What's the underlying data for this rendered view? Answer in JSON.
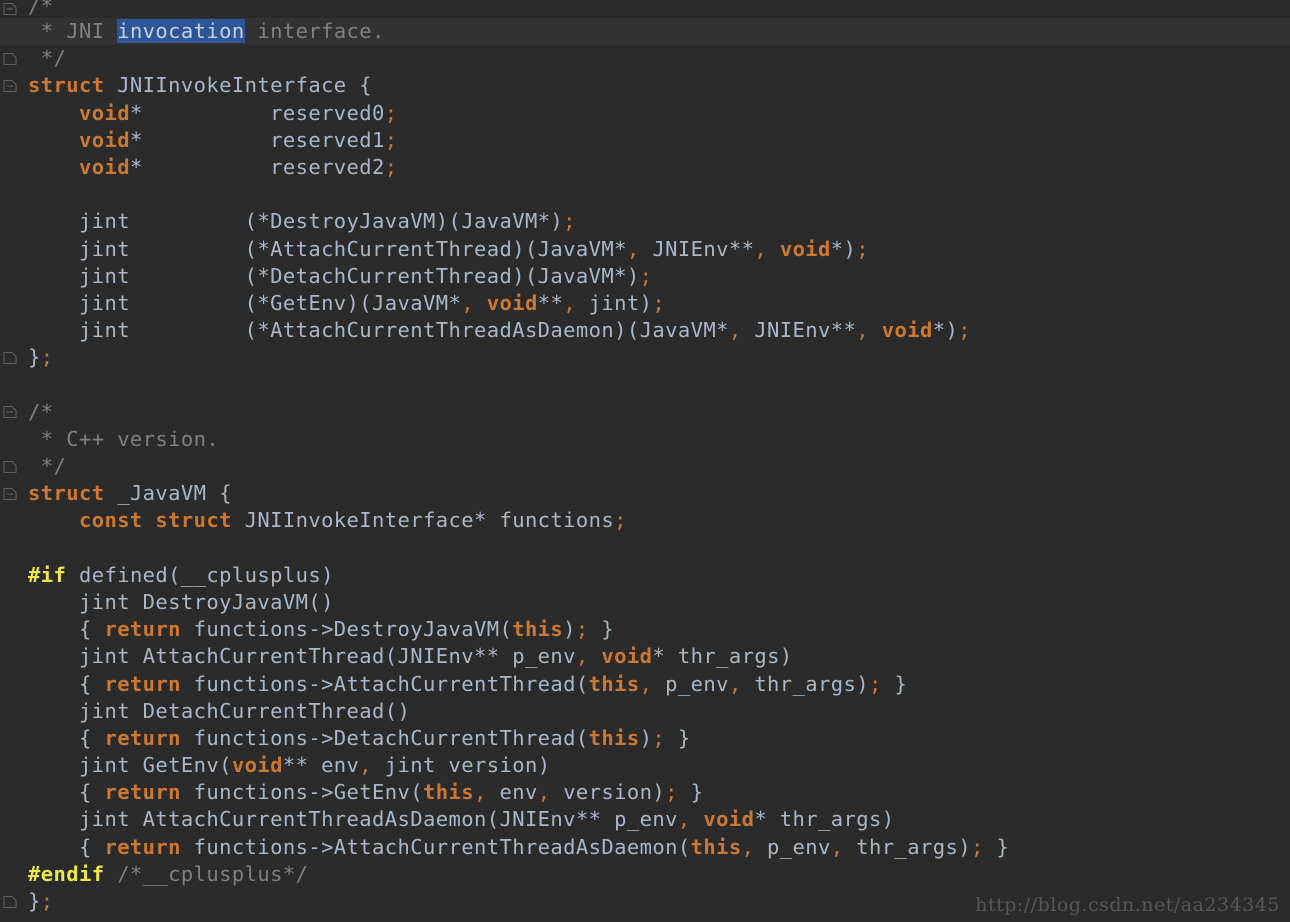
{
  "editor": {
    "theme_name": "darcula",
    "colors": {
      "background": "#2b2b2b",
      "highlight_line": "#323232",
      "keyword": "#cc7832",
      "identifier": "#a9b7c6",
      "comment": "#808080",
      "preprocessor": "#e8e84a",
      "selection": "#2c5699",
      "gutter_fold": "#606060",
      "watermark": "#575757"
    },
    "watermark": "http://blog.csdn.net/aa234345",
    "lines": [
      {
        "id": "line-1",
        "fold": "start",
        "highlight": false,
        "tokens": [
          {
            "t": "/*",
            "c": "cm"
          }
        ]
      },
      {
        "id": "line-2",
        "fold": "none",
        "highlight": true,
        "tokens": [
          {
            "t": " * JNI ",
            "c": "cm"
          },
          {
            "t": "invocation",
            "c": "sel"
          },
          {
            "t": " interface.",
            "c": "cm"
          }
        ]
      },
      {
        "id": "line-3",
        "fold": "end",
        "highlight": false,
        "tokens": [
          {
            "t": " */",
            "c": "cm"
          }
        ]
      },
      {
        "id": "line-4",
        "fold": "start",
        "highlight": false,
        "tokens": [
          {
            "t": "struct",
            "c": "kw"
          },
          {
            "t": " JNIInvokeInterface {",
            "c": "id"
          }
        ]
      },
      {
        "id": "line-5",
        "fold": "none",
        "highlight": false,
        "tokens": [
          {
            "t": "    ",
            "c": "id"
          },
          {
            "t": "void",
            "c": "kw"
          },
          {
            "t": "*          reserved0",
            "c": "id"
          },
          {
            "t": ";",
            "c": "pn"
          }
        ]
      },
      {
        "id": "line-6",
        "fold": "none",
        "highlight": false,
        "tokens": [
          {
            "t": "    ",
            "c": "id"
          },
          {
            "t": "void",
            "c": "kw"
          },
          {
            "t": "*          reserved1",
            "c": "id"
          },
          {
            "t": ";",
            "c": "pn"
          }
        ]
      },
      {
        "id": "line-7",
        "fold": "none",
        "highlight": false,
        "tokens": [
          {
            "t": "    ",
            "c": "id"
          },
          {
            "t": "void",
            "c": "kw"
          },
          {
            "t": "*          reserved2",
            "c": "id"
          },
          {
            "t": ";",
            "c": "pn"
          }
        ]
      },
      {
        "id": "line-8",
        "fold": "none",
        "highlight": false,
        "tokens": [
          {
            "t": "",
            "c": "id"
          }
        ]
      },
      {
        "id": "line-9",
        "fold": "none",
        "highlight": false,
        "tokens": [
          {
            "t": "    jint         (*DestroyJavaVM)(JavaVM*)",
            "c": "id"
          },
          {
            "t": ";",
            "c": "pn"
          }
        ]
      },
      {
        "id": "line-10",
        "fold": "none",
        "highlight": false,
        "tokens": [
          {
            "t": "    jint         (*AttachCurrentThread)(JavaVM*",
            "c": "id"
          },
          {
            "t": ",",
            "c": "pn"
          },
          {
            "t": " JNIEnv**",
            "c": "id"
          },
          {
            "t": ",",
            "c": "pn"
          },
          {
            "t": " ",
            "c": "id"
          },
          {
            "t": "void",
            "c": "kw"
          },
          {
            "t": "*)",
            "c": "id"
          },
          {
            "t": ";",
            "c": "pn"
          }
        ]
      },
      {
        "id": "line-11",
        "fold": "none",
        "highlight": false,
        "tokens": [
          {
            "t": "    jint         (*DetachCurrentThread)(JavaVM*)",
            "c": "id"
          },
          {
            "t": ";",
            "c": "pn"
          }
        ]
      },
      {
        "id": "line-12",
        "fold": "none",
        "highlight": false,
        "tokens": [
          {
            "t": "    jint         (*GetEnv)(JavaVM*",
            "c": "id"
          },
          {
            "t": ",",
            "c": "pn"
          },
          {
            "t": " ",
            "c": "id"
          },
          {
            "t": "void",
            "c": "kw"
          },
          {
            "t": "**",
            "c": "id"
          },
          {
            "t": ",",
            "c": "pn"
          },
          {
            "t": " jint)",
            "c": "id"
          },
          {
            "t": ";",
            "c": "pn"
          }
        ]
      },
      {
        "id": "line-13",
        "fold": "none",
        "highlight": false,
        "tokens": [
          {
            "t": "    jint         (*AttachCurrentThreadAsDaemon)(JavaVM*",
            "c": "id"
          },
          {
            "t": ",",
            "c": "pn"
          },
          {
            "t": " JNIEnv**",
            "c": "id"
          },
          {
            "t": ",",
            "c": "pn"
          },
          {
            "t": " ",
            "c": "id"
          },
          {
            "t": "void",
            "c": "kw"
          },
          {
            "t": "*)",
            "c": "id"
          },
          {
            "t": ";",
            "c": "pn"
          }
        ]
      },
      {
        "id": "line-14",
        "fold": "end",
        "highlight": false,
        "tokens": [
          {
            "t": "}",
            "c": "id"
          },
          {
            "t": ";",
            "c": "pn"
          }
        ]
      },
      {
        "id": "line-15",
        "fold": "none",
        "highlight": false,
        "tokens": [
          {
            "t": "",
            "c": "id"
          }
        ]
      },
      {
        "id": "line-16",
        "fold": "start",
        "highlight": false,
        "tokens": [
          {
            "t": "/*",
            "c": "cm"
          }
        ]
      },
      {
        "id": "line-17",
        "fold": "none",
        "highlight": false,
        "tokens": [
          {
            "t": " * C++ version.",
            "c": "cm"
          }
        ]
      },
      {
        "id": "line-18",
        "fold": "end",
        "highlight": false,
        "tokens": [
          {
            "t": " */",
            "c": "cm"
          }
        ]
      },
      {
        "id": "line-19",
        "fold": "start",
        "highlight": false,
        "tokens": [
          {
            "t": "struct",
            "c": "kw"
          },
          {
            "t": " _JavaVM {",
            "c": "id"
          }
        ]
      },
      {
        "id": "line-20",
        "fold": "none",
        "highlight": false,
        "tokens": [
          {
            "t": "    ",
            "c": "id"
          },
          {
            "t": "const struct",
            "c": "kw"
          },
          {
            "t": " JNIInvokeInterface* functions",
            "c": "id"
          },
          {
            "t": ";",
            "c": "pn"
          }
        ]
      },
      {
        "id": "line-21",
        "fold": "none",
        "highlight": false,
        "tokens": [
          {
            "t": "",
            "c": "id"
          }
        ]
      },
      {
        "id": "line-22",
        "fold": "none",
        "highlight": false,
        "tokens": [
          {
            "t": "#if",
            "c": "pp"
          },
          {
            "t": " defined(__cplusplus)",
            "c": "id"
          }
        ]
      },
      {
        "id": "line-23",
        "fold": "none",
        "highlight": false,
        "tokens": [
          {
            "t": "    jint DestroyJavaVM()",
            "c": "id"
          }
        ]
      },
      {
        "id": "line-24",
        "fold": "none",
        "highlight": false,
        "tokens": [
          {
            "t": "    { ",
            "c": "id"
          },
          {
            "t": "return",
            "c": "kw"
          },
          {
            "t": " functions->DestroyJavaVM(",
            "c": "id"
          },
          {
            "t": "this",
            "c": "kw"
          },
          {
            "t": ")",
            "c": "id"
          },
          {
            "t": ";",
            "c": "pn"
          },
          {
            "t": " }",
            "c": "id"
          }
        ]
      },
      {
        "id": "line-25",
        "fold": "none",
        "highlight": false,
        "tokens": [
          {
            "t": "    jint AttachCurrentThread(JNIEnv** p_env",
            "c": "id"
          },
          {
            "t": ",",
            "c": "pn"
          },
          {
            "t": " ",
            "c": "id"
          },
          {
            "t": "void",
            "c": "kw"
          },
          {
            "t": "* thr_args)",
            "c": "id"
          }
        ]
      },
      {
        "id": "line-26",
        "fold": "none",
        "highlight": false,
        "tokens": [
          {
            "t": "    { ",
            "c": "id"
          },
          {
            "t": "return",
            "c": "kw"
          },
          {
            "t": " functions->AttachCurrentThread(",
            "c": "id"
          },
          {
            "t": "this",
            "c": "kw"
          },
          {
            "t": ",",
            "c": "pn"
          },
          {
            "t": " p_env",
            "c": "id"
          },
          {
            "t": ",",
            "c": "pn"
          },
          {
            "t": " thr_args)",
            "c": "id"
          },
          {
            "t": ";",
            "c": "pn"
          },
          {
            "t": " }",
            "c": "id"
          }
        ]
      },
      {
        "id": "line-27",
        "fold": "none",
        "highlight": false,
        "tokens": [
          {
            "t": "    jint DetachCurrentThread()",
            "c": "id"
          }
        ]
      },
      {
        "id": "line-28",
        "fold": "none",
        "highlight": false,
        "tokens": [
          {
            "t": "    { ",
            "c": "id"
          },
          {
            "t": "return",
            "c": "kw"
          },
          {
            "t": " functions->DetachCurrentThread(",
            "c": "id"
          },
          {
            "t": "this",
            "c": "kw"
          },
          {
            "t": ")",
            "c": "id"
          },
          {
            "t": ";",
            "c": "pn"
          },
          {
            "t": " }",
            "c": "id"
          }
        ]
      },
      {
        "id": "line-29",
        "fold": "none",
        "highlight": false,
        "tokens": [
          {
            "t": "    jint GetEnv(",
            "c": "id"
          },
          {
            "t": "void",
            "c": "kw"
          },
          {
            "t": "** env",
            "c": "id"
          },
          {
            "t": ",",
            "c": "pn"
          },
          {
            "t": " jint version)",
            "c": "id"
          }
        ]
      },
      {
        "id": "line-30",
        "fold": "none",
        "highlight": false,
        "tokens": [
          {
            "t": "    { ",
            "c": "id"
          },
          {
            "t": "return",
            "c": "kw"
          },
          {
            "t": " functions->GetEnv(",
            "c": "id"
          },
          {
            "t": "this",
            "c": "kw"
          },
          {
            "t": ",",
            "c": "pn"
          },
          {
            "t": " env",
            "c": "id"
          },
          {
            "t": ",",
            "c": "pn"
          },
          {
            "t": " version)",
            "c": "id"
          },
          {
            "t": ";",
            "c": "pn"
          },
          {
            "t": " }",
            "c": "id"
          }
        ]
      },
      {
        "id": "line-31",
        "fold": "none",
        "highlight": false,
        "tokens": [
          {
            "t": "    jint AttachCurrentThreadAsDaemon(JNIEnv** p_env",
            "c": "id"
          },
          {
            "t": ",",
            "c": "pn"
          },
          {
            "t": " ",
            "c": "id"
          },
          {
            "t": "void",
            "c": "kw"
          },
          {
            "t": "* thr_args)",
            "c": "id"
          }
        ]
      },
      {
        "id": "line-32",
        "fold": "none",
        "highlight": false,
        "tokens": [
          {
            "t": "    { ",
            "c": "id"
          },
          {
            "t": "return",
            "c": "kw"
          },
          {
            "t": " functions->AttachCurrentThreadAsDaemon(",
            "c": "id"
          },
          {
            "t": "this",
            "c": "kw"
          },
          {
            "t": ",",
            "c": "pn"
          },
          {
            "t": " p_env",
            "c": "id"
          },
          {
            "t": ",",
            "c": "pn"
          },
          {
            "t": " thr_args)",
            "c": "id"
          },
          {
            "t": ";",
            "c": "pn"
          },
          {
            "t": " }",
            "c": "id"
          }
        ]
      },
      {
        "id": "line-33",
        "fold": "none",
        "highlight": false,
        "tokens": [
          {
            "t": "#endif",
            "c": "pp"
          },
          {
            "t": " /*__cplusplus*/",
            "c": "cm"
          }
        ]
      },
      {
        "id": "line-34",
        "fold": "end",
        "highlight": false,
        "tokens": [
          {
            "t": "}",
            "c": "id"
          },
          {
            "t": ";",
            "c": "pn"
          }
        ]
      }
    ]
  }
}
